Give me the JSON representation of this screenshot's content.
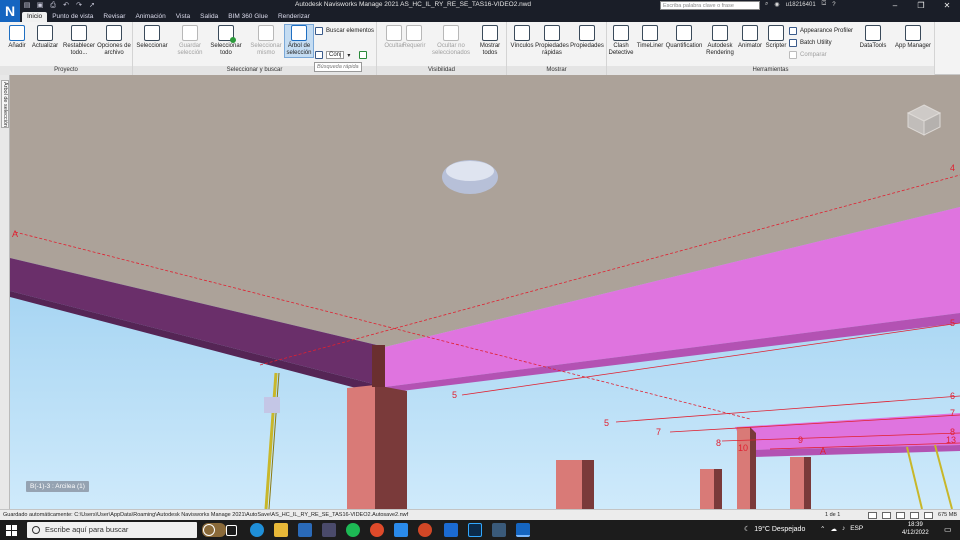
{
  "app": {
    "logo": "N",
    "title": "Autodesk Navisworks Manage 2021   AS_HC_IL_RY_RE_SE_TAS16-VIDEO2.nwd",
    "search_placeholder": "Escriba palabra clave o frase",
    "user": "u18216401"
  },
  "qat_icons": [
    "open-icon",
    "save-icon",
    "print-icon",
    "undo-icon",
    "redo-icon",
    "cursor-icon"
  ],
  "tabs": [
    "Inicio",
    "Punto de vista",
    "Revisar",
    "Animación",
    "Vista",
    "Salida",
    "BIM 360 Glue",
    "Renderizar"
  ],
  "active_tab": "Inicio",
  "ribbon": {
    "panels": {
      "proyecto": "Proyecto",
      "seleccionar": "Seleccionar y buscar",
      "visibilidad": "Visibilidad",
      "mostrar": "Mostrar",
      "herramientas": "Herramientas"
    },
    "buttons": {
      "anadir": "Añadir",
      "actualizar": "Actualizar",
      "restablecer": "Restablecer todo...",
      "opciones": "Opciones de archivo",
      "seleccionar": "Seleccionar",
      "guardar_sel": "Guardar selección",
      "seleccionar_todo": "Seleccionar todo",
      "sel_mismo": "Seleccionar mismo",
      "arbol": "Árbol de selección",
      "buscar": "Buscar elementos",
      "quick_search": "Búsqueda rápida",
      "conj": "Conj",
      "ocultar": "Ocultar",
      "requerir": "Requerir",
      "ocultar_no_sel": "Ocultar no seleccionados",
      "mostrar_todos": "Mostrar todos",
      "vinculos": "Vínculos",
      "prop_rapidas": "Propiedades rápidas",
      "propiedades": "Propiedades",
      "clash": "Clash Detective",
      "timeliner": "TimeLiner",
      "quantification": "Quantification",
      "rendering": "Autodesk Rendering",
      "animator": "Animator",
      "scripter": "Scripter",
      "appearance": "Appearance Profiler",
      "batch": "Batch Utility",
      "comparar": "Comparar",
      "datatools": "DataTools",
      "app_manager": "App Manager"
    }
  },
  "sidebar": {
    "selection_tree_tab": "Árbol de selección"
  },
  "viewport": {
    "viewpoint_label": "B(-1)-3 : Arcilea (1)",
    "grid_labels": [
      "4",
      "A",
      "5",
      "5",
      "6",
      "5",
      "7",
      "7",
      "8",
      "8",
      "9",
      "10",
      "13",
      "A"
    ]
  },
  "status": {
    "autosave": "Guardado automáticamente: C:\\Users\\User\\AppData\\Roaming\\Autodesk Navisworks Manage 2021\\AutoSave\\AS_HC_IL_RY_RE_SE_TAS16-VIDEO2.Autosave2.nwf",
    "page": "1 de 1",
    "memory": "675 MB"
  },
  "taskbar": {
    "search_placeholder": "Escribe aquí para buscar",
    "weather": "19°C  Despejado",
    "lang": "ESP",
    "time": "18:39",
    "date": "4/12/2022"
  }
}
